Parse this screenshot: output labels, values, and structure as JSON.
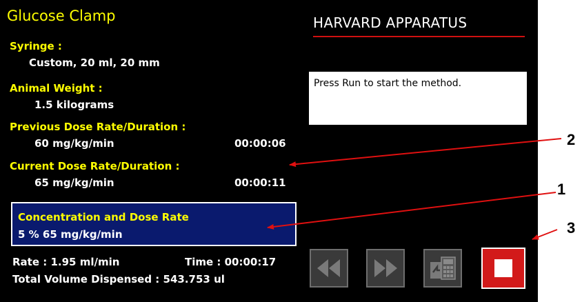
{
  "app": {
    "title": "Glucose Clamp",
    "brand": "HARVARD APPARATUS"
  },
  "fields": {
    "syringe_label": "Syringe :",
    "syringe_value": "Custom, 20 ml, 20 mm",
    "weight_label": "Animal Weight :",
    "weight_value": "1.5 kilograms",
    "prev_label": "Previous Dose Rate/Duration :",
    "prev_rate": "60 mg/kg/min",
    "prev_duration": "00:00:06",
    "curr_label": "Current Dose Rate/Duration :",
    "curr_rate": "65 mg/kg/min",
    "curr_duration": "00:00:11"
  },
  "concentration": {
    "label": "Concentration and Dose Rate",
    "value": "5 %  65 mg/kg/min"
  },
  "status": {
    "rate": "Rate :  1.95 ml/min",
    "time": "Time :  00:00:17",
    "total_volume": "Total Volume Dispensed : 543.753 ul"
  },
  "message": "Press Run to start the method.",
  "controls": [
    "rewind-icon",
    "fast-forward-icon",
    "method-keypad-icon",
    "stop-icon"
  ],
  "callouts": {
    "one": "1",
    "two": "2",
    "three": "3"
  },
  "colors": {
    "label_yellow": "#ffff00",
    "panel_blue": "#0a1a6e",
    "stop_red": "#d21a1a",
    "arrow_red": "#e01010",
    "brand_underline": "#d01010"
  }
}
